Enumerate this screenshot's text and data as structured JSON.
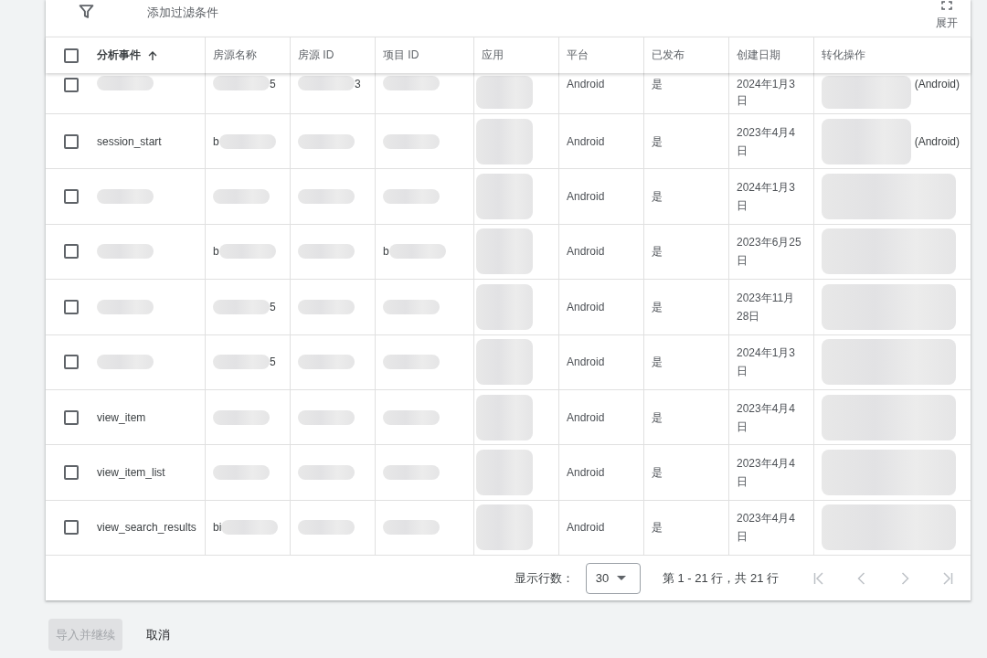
{
  "toolbar": {
    "filter": {
      "placeholder": "添加过滤条件"
    },
    "expand_label": "展开"
  },
  "table": {
    "header_checkbox": {
      "checked": false
    },
    "columns": [
      {
        "label": "分析事件",
        "sorted": true,
        "ascending": true
      },
      {
        "label": "房源名称",
        "sorted": false
      },
      {
        "label": "房源 ID",
        "sorted": false
      },
      {
        "label": "项目 ID",
        "sorted": false
      },
      {
        "label": "应用",
        "sorted": false
      },
      {
        "label": "平台",
        "sorted": false
      },
      {
        "label": "已发布",
        "sorted": false
      },
      {
        "label": "创建日期",
        "sorted": false
      },
      {
        "label": "转化操作",
        "sorted": false
      }
    ],
    "rows": [
      {
        "selected": false,
        "cells": [
          {
            "redacted": true
          },
          {
            "redacted": true,
            "tail": "5"
          },
          {
            "redacted": true,
            "tail": "3"
          },
          {
            "redacted": true
          },
          {
            "redacted": true
          },
          {
            "text": "Android"
          },
          {
            "text": "是"
          },
          {
            "text": "2024年1月3日"
          },
          {
            "redacted": true,
            "tail": "(Android)"
          }
        ]
      },
      {
        "selected": false,
        "cells": [
          {
            "text": "session_start"
          },
          {
            "redacted": true,
            "head": "b"
          },
          {
            "redacted": true
          },
          {
            "redacted": true
          },
          {
            "redacted": true
          },
          {
            "text": "Android"
          },
          {
            "text": "是"
          },
          {
            "text": "2023年4月4日"
          },
          {
            "redacted": true,
            "tail": "(Android)"
          }
        ]
      },
      {
        "selected": false,
        "cells": [
          {
            "redacted": true
          },
          {
            "redacted": true
          },
          {
            "redacted": true
          },
          {
            "redacted": true
          },
          {
            "redacted": true
          },
          {
            "text": "Android"
          },
          {
            "text": "是"
          },
          {
            "text": "2024年1月3日"
          },
          {
            "redacted": true
          }
        ]
      },
      {
        "selected": false,
        "cells": [
          {
            "redacted": true
          },
          {
            "redacted": true,
            "head": "b"
          },
          {
            "redacted": true
          },
          {
            "redacted": true,
            "head": "b"
          },
          {
            "redacted": true
          },
          {
            "text": "Android"
          },
          {
            "text": "是"
          },
          {
            "text": "2023年6月25日"
          },
          {
            "redacted": true
          }
        ]
      },
      {
        "selected": false,
        "cells": [
          {
            "redacted": true
          },
          {
            "redacted": true,
            "tail": "5"
          },
          {
            "redacted": true
          },
          {
            "redacted": true
          },
          {
            "redacted": true
          },
          {
            "text": "Android"
          },
          {
            "text": "是"
          },
          {
            "text": "2023年11月28日"
          },
          {
            "redacted": true
          }
        ]
      },
      {
        "selected": false,
        "cells": [
          {
            "redacted": true
          },
          {
            "redacted": true,
            "tail": "5"
          },
          {
            "redacted": true
          },
          {
            "redacted": true
          },
          {
            "redacted": true
          },
          {
            "text": "Android"
          },
          {
            "text": "是"
          },
          {
            "text": "2024年1月3日"
          },
          {
            "redacted": true
          }
        ]
      },
      {
        "selected": false,
        "cells": [
          {
            "text": "view_item"
          },
          {
            "redacted": true
          },
          {
            "redacted": true
          },
          {
            "redacted": true
          },
          {
            "redacted": true
          },
          {
            "text": "Android"
          },
          {
            "text": "是"
          },
          {
            "text": "2023年4月4日"
          },
          {
            "redacted": true
          }
        ]
      },
      {
        "selected": false,
        "cells": [
          {
            "text": "view_item_list"
          },
          {
            "redacted": true
          },
          {
            "redacted": true
          },
          {
            "redacted": true
          },
          {
            "redacted": true
          },
          {
            "text": "Android"
          },
          {
            "text": "是"
          },
          {
            "text": "2023年4月4日"
          },
          {
            "redacted": true
          }
        ]
      },
      {
        "selected": false,
        "cells": [
          {
            "text": "view_search_results"
          },
          {
            "redacted": true,
            "head": "bi"
          },
          {
            "redacted": true
          },
          {
            "redacted": true
          },
          {
            "redacted": true
          },
          {
            "text": "Android"
          },
          {
            "text": "是"
          },
          {
            "text": "2023年4月4日"
          },
          {
            "redacted": true
          }
        ]
      }
    ]
  },
  "pagination": {
    "rows_label": "显示行数：",
    "rows_per_page": "30",
    "range": "第 1 - 21 行，共 21 行",
    "buttons": [
      {
        "kind": "first",
        "disabled": true
      },
      {
        "kind": "previous",
        "disabled": true
      },
      {
        "kind": "next",
        "disabled": true
      },
      {
        "kind": "last",
        "disabled": true
      }
    ]
  },
  "actions": [
    {
      "label": "导入并继续",
      "kind": "primary",
      "disabled": true
    },
    {
      "label": "取消",
      "kind": "text",
      "disabled": false
    }
  ]
}
